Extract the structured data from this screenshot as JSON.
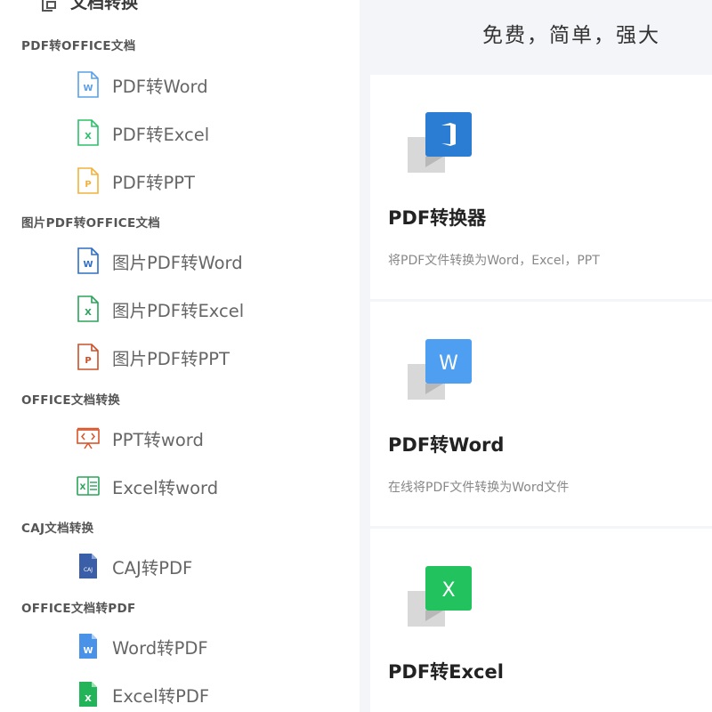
{
  "menu": {
    "top_title": "文档转换",
    "sections": [
      {
        "title": "PDF转OFFICE文档",
        "items": [
          {
            "label": "PDF转Word",
            "icon": "word-file-outline-icon"
          },
          {
            "label": "PDF转Excel",
            "icon": "excel-file-outline-icon"
          },
          {
            "label": "PDF转PPT",
            "icon": "ppt-file-outline-icon"
          }
        ]
      },
      {
        "title": "图片PDF转OFFICE文档",
        "items": [
          {
            "label": "图片PDF转Word",
            "icon": "word-file-outline-icon"
          },
          {
            "label": "图片PDF转Excel",
            "icon": "excel-file-outline-icon"
          },
          {
            "label": "图片PDF转PPT",
            "icon": "ppt-file-outline-icon"
          }
        ]
      },
      {
        "title": "OFFICE文档转换",
        "items": [
          {
            "label": "PPT转word",
            "icon": "presentation-icon"
          },
          {
            "label": "Excel转word",
            "icon": "spreadsheet-icon"
          }
        ]
      },
      {
        "title": "CAJ文档转换",
        "items": [
          {
            "label": "CAJ转PDF",
            "icon": "caj-file-icon"
          }
        ]
      },
      {
        "title": "OFFICE文档转PDF",
        "items": [
          {
            "label": "Word转PDF",
            "icon": "word-file-filled-icon"
          },
          {
            "label": "Excel转PDF",
            "icon": "excel-file-filled-icon"
          }
        ]
      }
    ]
  },
  "panel": {
    "slogan": "免费，简单，强大",
    "cards": [
      {
        "title": "PDF转换器",
        "desc": "将PDF文件转换为Word，Excel，PPT",
        "icon_letter": "",
        "icon": "office-logo-icon",
        "color": "#2b7cd3"
      },
      {
        "title": "PDF转Word",
        "desc": "在线将PDF文件转换为Word文件",
        "icon_letter": "W",
        "icon": "word-letter-icon",
        "color": "#4e9ef2"
      },
      {
        "title": "PDF转Excel",
        "desc": "",
        "icon_letter": "X",
        "icon": "excel-letter-icon",
        "color": "#22c25e"
      }
    ]
  },
  "colors": {
    "word": "#2f6fc4",
    "word_light": "#5aa0e6",
    "excel": "#2aa35a",
    "excel_light": "#2bc06a",
    "ppt": "#c9502a",
    "ppt_light": "#f0b23c",
    "panel_bg": "#f4f5f8"
  }
}
